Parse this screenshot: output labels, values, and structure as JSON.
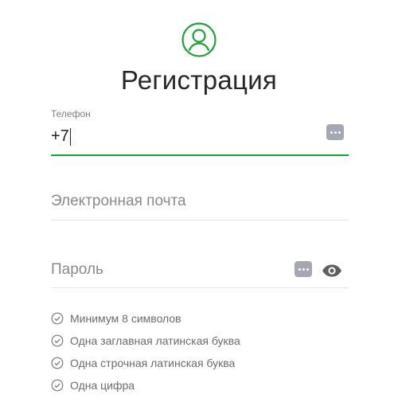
{
  "page": {
    "title": "Регистрация"
  },
  "icons": {
    "avatar": "user-circle-icon",
    "password_manager": "dots-icon",
    "show_password": "eye-icon",
    "rule_check": "check-circle-icon"
  },
  "colors": {
    "accent": "#21a038",
    "muted_icon": "#a5a7b2",
    "rule_text": "#6b6b6b"
  },
  "form": {
    "phone": {
      "label": "Телефон",
      "value": "+7"
    },
    "email": {
      "placeholder": "Электронная почта",
      "value": ""
    },
    "password": {
      "placeholder": "Пароль",
      "value": ""
    }
  },
  "password_rules": [
    {
      "label": "Минимум 8 символов"
    },
    {
      "label": "Одна заглавная латинская буква"
    },
    {
      "label": "Одна строчная латинская буква"
    },
    {
      "label": "Одна цифра"
    }
  ]
}
